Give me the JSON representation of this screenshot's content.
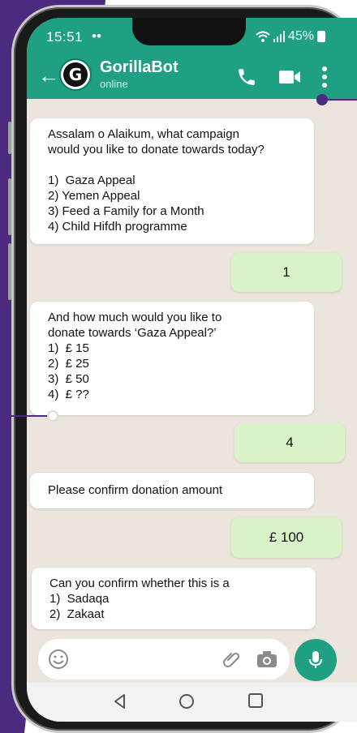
{
  "status_bar": {
    "time": "15:51",
    "dots": "••",
    "battery": "45%"
  },
  "header": {
    "bot_name": "GorillaBot",
    "bot_status": "online",
    "avatar_letter": "G"
  },
  "messages": [
    {
      "from": "bot",
      "lines": [
        "Assalam o Alaikum, what campaign",
        "would you like to donate towards today?",
        "",
        "1)  Gaza Appeal",
        "2) Yemen Appeal",
        "3) Feed a Family for a Month",
        "4) Child Hifdh programme"
      ]
    },
    {
      "from": "user",
      "text": "1"
    },
    {
      "from": "bot",
      "lines": [
        "And how much would you like to",
        "donate towards ‘Gaza Appeal?’",
        "1)  £ 15",
        "2)  £ 25",
        "3)  £ 50",
        "4)  £ ??"
      ]
    },
    {
      "from": "user",
      "text": "4"
    },
    {
      "from": "bot",
      "lines": [
        "Please confirm donation amount"
      ]
    },
    {
      "from": "user",
      "text": "£ 100"
    },
    {
      "from": "bot",
      "lines": [
        "Can you confirm whether this is a",
        "1)  Sadaqa",
        "2)  Zakaat"
      ]
    }
  ],
  "colors": {
    "accent": "#1fa083",
    "purple": "#4b2a80",
    "chat_bg": "#ece5dd",
    "out_bubble": "#d9f3c9"
  },
  "icons": [
    "back-arrow-icon",
    "phone-icon",
    "video-icon",
    "more-icon",
    "emoji-icon",
    "attach-icon",
    "camera-icon",
    "mic-icon",
    "nav-back-icon",
    "nav-home-icon",
    "nav-recent-icon"
  ]
}
